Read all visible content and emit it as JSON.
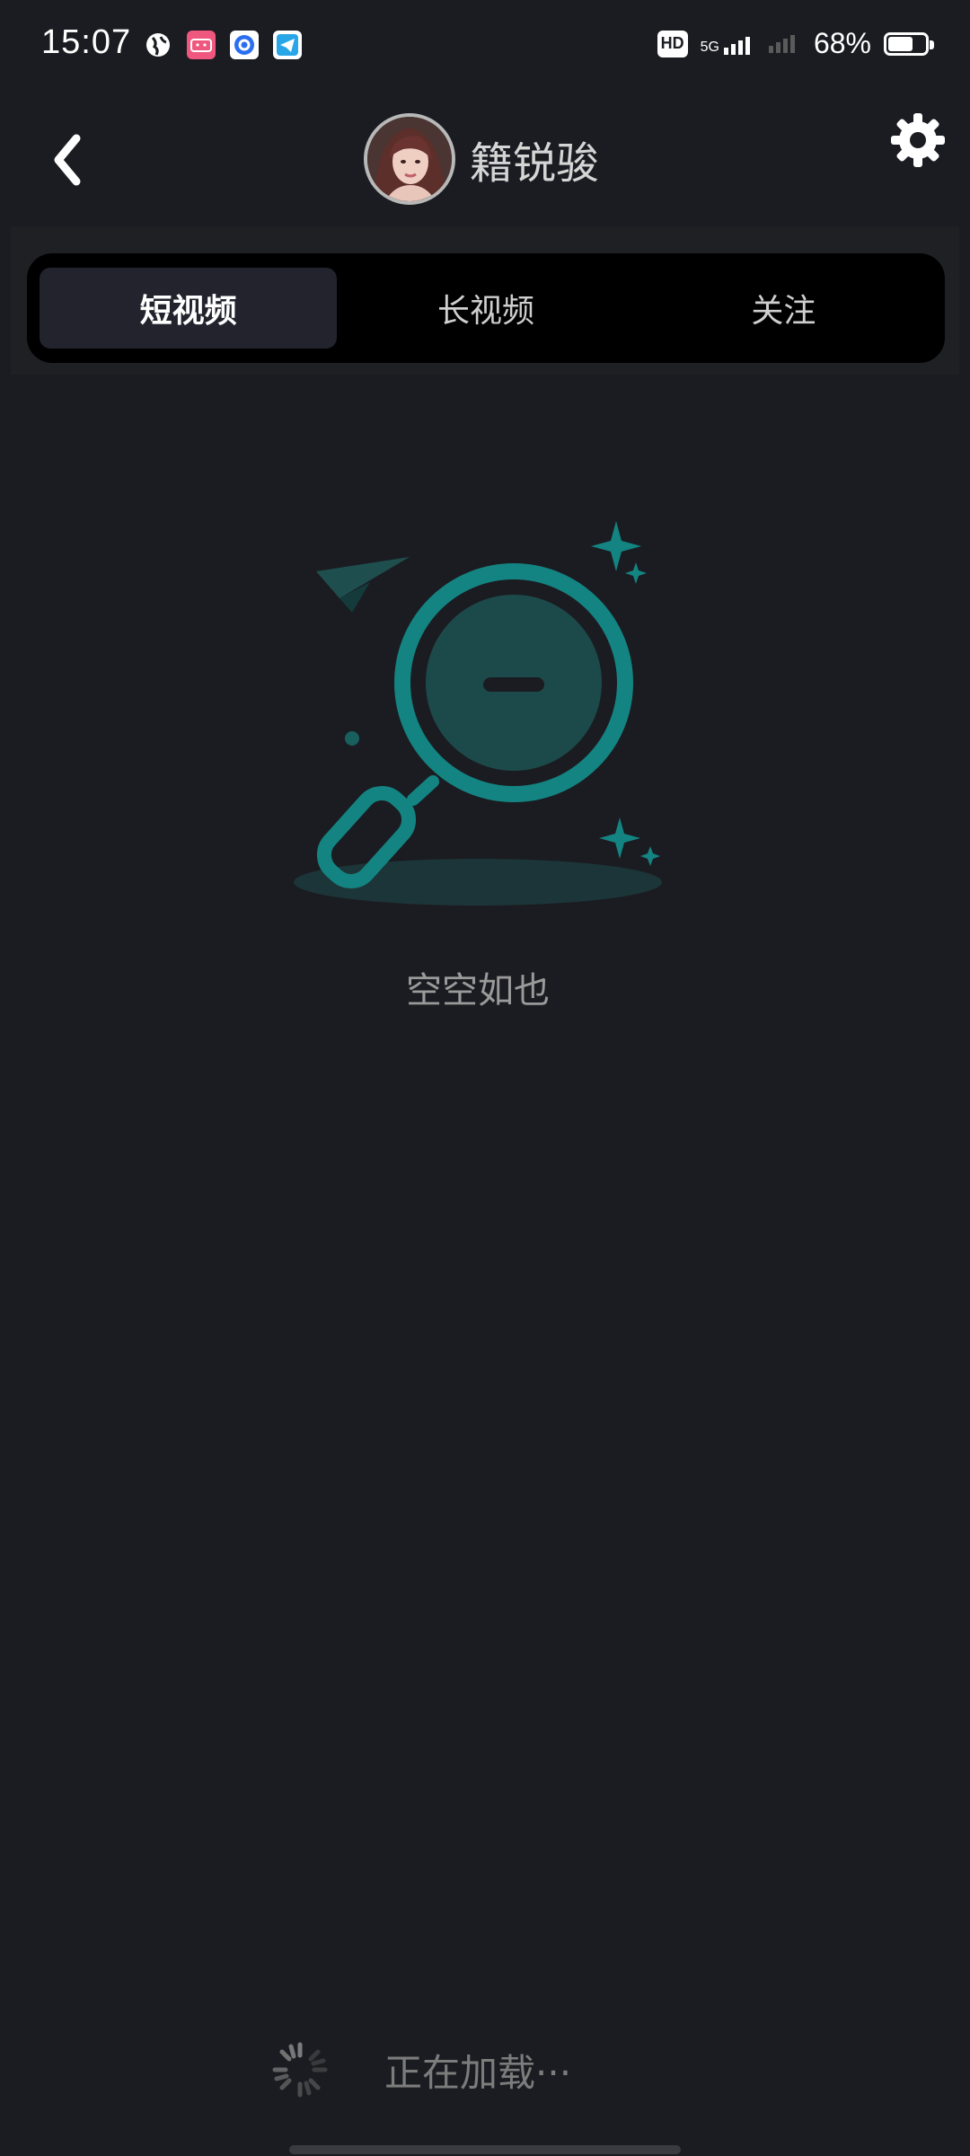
{
  "status_bar": {
    "time": "15:07",
    "battery": "68%",
    "battery_level": 0.68,
    "network": "5G",
    "hd_label": "HD",
    "app_icons": [
      "globe-icon",
      "bilibili-icon",
      "browser-icon",
      "telegram-icon"
    ]
  },
  "header": {
    "back_icon": "chevron-left-icon",
    "username": "籍锐骏",
    "settings_icon": "gear-icon"
  },
  "tabs": [
    {
      "label": "短视频",
      "active": true
    },
    {
      "label": "长视频",
      "active": false
    },
    {
      "label": "关注",
      "active": false
    }
  ],
  "empty_state": {
    "icon": "empty-search-illustration",
    "message": "空空如也"
  },
  "loading": {
    "icon": "spinner-icon",
    "text": "正在加载···"
  },
  "colors": {
    "background": "#1b1c21",
    "accent": "#138482",
    "tab_active": "#22232d"
  }
}
